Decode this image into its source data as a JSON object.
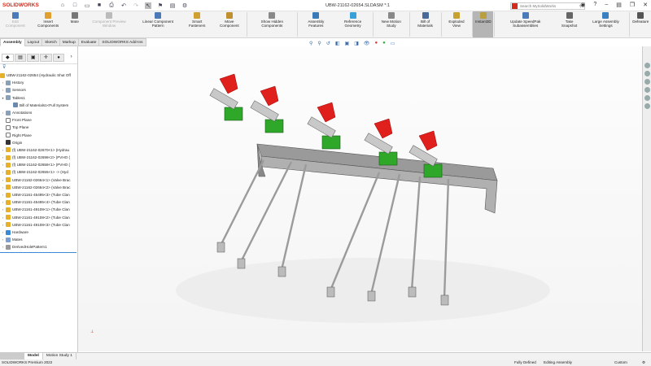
{
  "app": {
    "brand": "SOLIDWORKS",
    "document_title": "UBW-21162-02654.SLDASM *:1",
    "search_placeholder": "Search MySolidWorks"
  },
  "ribbon": [
    {
      "label": "Edit Component",
      "disabled": true
    },
    {
      "label": "Insert Components"
    },
    {
      "label": "Mate"
    },
    {
      "label": "Component Preview Window",
      "disabled": true
    },
    {
      "label": "Linear Component Pattern"
    },
    {
      "label": "Smart Fasteners"
    },
    {
      "label": "Move Component"
    },
    {
      "label": "Show Hidden Components"
    },
    {
      "label": "Assembly Features"
    },
    {
      "label": "Reference Geometry"
    },
    {
      "label": "New Motion Study"
    },
    {
      "label": "Bill of Materials"
    },
    {
      "label": "Exploded View"
    },
    {
      "label": "Instant3D",
      "active": true
    },
    {
      "label": "Update SpeedPak Subassemblies"
    },
    {
      "label": "Take Snapshot"
    },
    {
      "label": "Large Assembly Settings"
    },
    {
      "label": "Defeature"
    }
  ],
  "tabs": [
    "Assembly",
    "Layout",
    "Sketch",
    "Markup",
    "Evaluate",
    "SOLIDWORKS Add-Ins"
  ],
  "tree": [
    {
      "label": "UBW-21162-02654 (Hydraulic Shut Off",
      "icon": "assembly"
    },
    {
      "label": "History",
      "icon": "folder"
    },
    {
      "label": "Sensors",
      "icon": "folder"
    },
    {
      "label": "Tables1",
      "icon": "folder"
    },
    {
      "label": "Bill of Materials1<Full System",
      "icon": "table"
    },
    {
      "label": "Annotations",
      "icon": "folder"
    },
    {
      "label": "Front Plane",
      "icon": "plane"
    },
    {
      "label": "Top Plane",
      "icon": "plane"
    },
    {
      "label": "Right Plane",
      "icon": "plane"
    },
    {
      "label": "Origin",
      "icon": "origin"
    },
    {
      "label": "(f) UBW-21162-02670<1> (Hydrau",
      "icon": "assembly"
    },
    {
      "label": "(f) UBW-21162-02698<2> (PVHO (",
      "icon": "assembly"
    },
    {
      "label": "(f) UBW-21162-02658<1> (PVHO (",
      "icon": "assembly"
    },
    {
      "label": "(f) UBW-21162-02655<1> -> (Hyd",
      "icon": "assembly"
    },
    {
      "label": "UBW-21162-02664<1> (Valve Brac",
      "icon": "assembly"
    },
    {
      "label": "UBW-21162-02664<2> (Valve Brac",
      "icon": "assembly"
    },
    {
      "label": "UBW-21161-45495<3> (Tube Clan",
      "icon": "assembly"
    },
    {
      "label": "UBW-21161-45495<4> (Tube Clan",
      "icon": "assembly"
    },
    {
      "label": "UBW-21161-49108<1> (Tube Clan",
      "icon": "assembly"
    },
    {
      "label": "UBW-21161-49108<2> (Tube Clan",
      "icon": "assembly"
    },
    {
      "label": "UBW-21161-49108<3> (Tube Clan",
      "icon": "assembly"
    },
    {
      "label": "Hardware",
      "icon": "folder-blue"
    },
    {
      "label": "Mates",
      "icon": "mates"
    },
    {
      "label": "DerivedHolePattern1",
      "icon": "pattern"
    }
  ],
  "bottom_tabs": [
    "Model",
    "Motion Study 1"
  ],
  "status": {
    "product": "SOLIDWORKS Premium 2022",
    "state": "Fully Defined",
    "mode": "Editing Assembly",
    "units": "Custom"
  },
  "colors": {
    "brand": "#d52b1e",
    "valve_handle": "#e0201c",
    "valve_body": "#2fa82a"
  }
}
